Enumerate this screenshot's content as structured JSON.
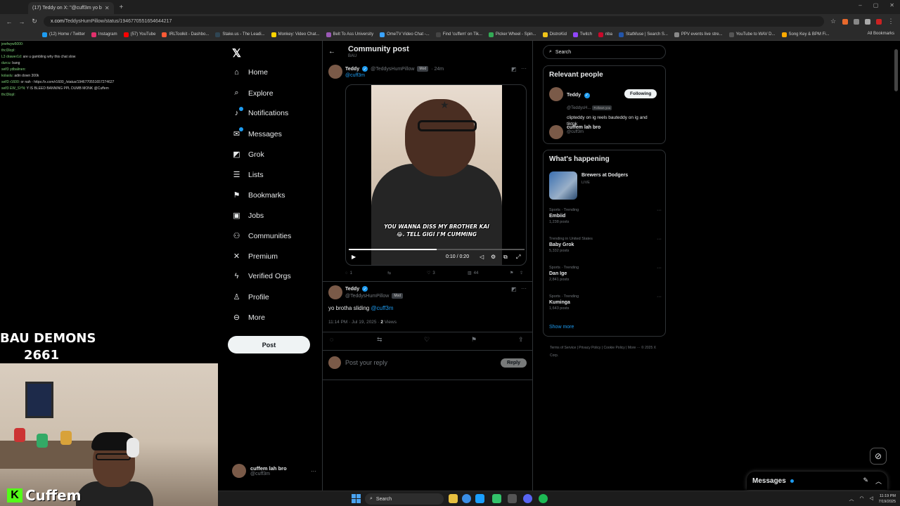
{
  "browser": {
    "tabs": [
      {
        "label": "(17) Teddy on X: \"@cuff3m yo b"
      }
    ],
    "url_host": "x.com",
    "url_path": "/TeddysHumPillow/status/1946770551654644217",
    "bookmarks": [
      {
        "label": "(12) Home / Twitter",
        "color": "#1d9bf0"
      },
      {
        "label": "Instagram",
        "color": "#e1306c"
      },
      {
        "label": "(57) YouTube",
        "color": "#ff0000"
      },
      {
        "label": "IRLToolkit - Dashbo...",
        "color": "#ff5a36"
      },
      {
        "label": "Stake.us - The Leadi...",
        "color": "#2f4553"
      },
      {
        "label": "Monkey: Video Chat...",
        "color": "#ffd400"
      },
      {
        "label": "Belt To Ass University",
        "color": "#9b59b6"
      },
      {
        "label": "OmeTV Video Chat -...",
        "color": "#3aa3ff"
      },
      {
        "label": "Find 'cuffem' on Tik...",
        "color": "#444444"
      },
      {
        "label": "Picker Wheel - Spin...",
        "color": "#33aa55"
      },
      {
        "label": "DistroKid",
        "color": "#f0c419"
      },
      {
        "label": "Twitch",
        "color": "#9146ff"
      },
      {
        "label": "nba",
        "color": "#c9082a"
      },
      {
        "label": "StatMuse | Search S...",
        "color": "#2255aa"
      },
      {
        "label": "PPV events live stre...",
        "color": "#888888"
      },
      {
        "label": "YouTube to WAV D...",
        "color": "#555555"
      },
      {
        "label": "Song Key & BPM Fi...",
        "color": "#ffaa00"
      }
    ],
    "all_bookmarks": "All Bookmarks"
  },
  "chat": [
    {
      "user": "jewfwyw5000:",
      "text": ""
    },
    {
      "user": "thcl3lopl:",
      "text": ""
    },
    {
      "user": "L3 drawer1d:",
      "text": "are u gambling why this chat slow"
    },
    {
      "user": "durcu:",
      "text": "bang"
    },
    {
      "user": "self3 ydbalinen:",
      "text": ""
    },
    {
      "user": "kolaslu:",
      "text": "adin down 300k"
    },
    {
      "user": "self3 r1600:",
      "text": "or nah - https://x.com/r1600_/status/1946770551657274627"
    },
    {
      "user": "self3 EW_SYN:",
      "text": "Y IS BLEED BANNING PPL DUMB MONK @Cuffem"
    },
    {
      "user": "thcl3lopl:",
      "text": ""
    }
  ],
  "overlay": {
    "title": "BAU DEMONS",
    "count": "2661",
    "streamer": "Cuffem"
  },
  "nav": {
    "items": [
      {
        "label": "Home",
        "icon": "home-icon",
        "glyph": "⌂"
      },
      {
        "label": "Explore",
        "icon": "search-icon",
        "glyph": "⌕"
      },
      {
        "label": "Notifications",
        "icon": "bell-icon",
        "glyph": "🔔"
      },
      {
        "label": "Messages",
        "icon": "mail-icon",
        "glyph": "✉"
      },
      {
        "label": "Grok",
        "icon": "grok-icon",
        "glyph": "◩"
      },
      {
        "label": "Lists",
        "icon": "list-icon",
        "glyph": "☰"
      },
      {
        "label": "Bookmarks",
        "icon": "bookmark-icon",
        "glyph": "⚑"
      },
      {
        "label": "Jobs",
        "icon": "briefcase-icon",
        "glyph": "▣"
      },
      {
        "label": "Communities",
        "icon": "people-icon",
        "glyph": "⚇"
      },
      {
        "label": "Premium",
        "icon": "x-premium-icon",
        "glyph": "𝕏"
      },
      {
        "label": "Verified Orgs",
        "icon": "lightning-icon",
        "glyph": "⚡"
      },
      {
        "label": "Profile",
        "icon": "person-icon",
        "glyph": "♙"
      },
      {
        "label": "More",
        "icon": "more-circle-icon",
        "glyph": "⋯"
      }
    ],
    "post_button": "Post",
    "account": {
      "name": "cuffem lah bro",
      "handle": "@cuff3m"
    }
  },
  "main": {
    "title": "Community post",
    "subtitle": "BAU",
    "post": {
      "name": "Teddy",
      "handle": "@TeddysHumPillow",
      "badge": "Mod",
      "time": "· 24m",
      "replying": "@cuff3m",
      "caption": "YOU WANNA DISS MY BROTHER KAI 😂. TELL GIGI I'M CUMMING",
      "video_time": "0:10 / 0:20",
      "video_progress": 0.5,
      "stats": {
        "replies": "1",
        "reposts": "",
        "likes": "3",
        "views": "44"
      }
    },
    "reply": {
      "name": "Teddy",
      "handle": "@TeddysHumPillow",
      "badge": "Mod",
      "text": "yo brotha sliding",
      "mention": "@cuff3m",
      "time": "11:14 PM · Jul 19, 2025 · ",
      "views_count": "2",
      "views_label": " Views"
    },
    "compose_placeholder": "Post your reply",
    "reply_button": "Reply"
  },
  "right": {
    "search_placeholder": "Search",
    "relevant": {
      "title": "Relevant people",
      "people": [
        {
          "name": "Teddy",
          "handle": "@TeddysH...",
          "follows": "Follows you",
          "bio": "clipteddy on ig reels bauteddy on ig and tiktok",
          "button": "Following"
        },
        {
          "name": "cuffem lah bro",
          "handle": "@cuff3m"
        }
      ]
    },
    "happening": {
      "title": "What's happening",
      "event": {
        "title": "Brewers at Dodgers",
        "status": "LIVE"
      },
      "trends": [
        {
          "cat": "Sports · Trending",
          "title": "Embiid",
          "posts": "1,238 posts"
        },
        {
          "cat": "Trending in United States",
          "title": "Baby Grok",
          "posts": "5,332 posts"
        },
        {
          "cat": "Sports · Trending",
          "title": "Dan Ige",
          "posts": "2,841 posts"
        },
        {
          "cat": "Sports · Trending",
          "title": "Kuminga",
          "posts": "1,643 posts"
        }
      ],
      "show_more": "Show more"
    },
    "footer": "Terms of Service  |  Privacy Policy  |  Cookie Policy  |  More ···  © 2025 X Corp."
  },
  "dock": {
    "messages": "Messages"
  },
  "taskbar": {
    "search": "Search",
    "time": "11:19 PM",
    "date": "7/19/2025"
  }
}
